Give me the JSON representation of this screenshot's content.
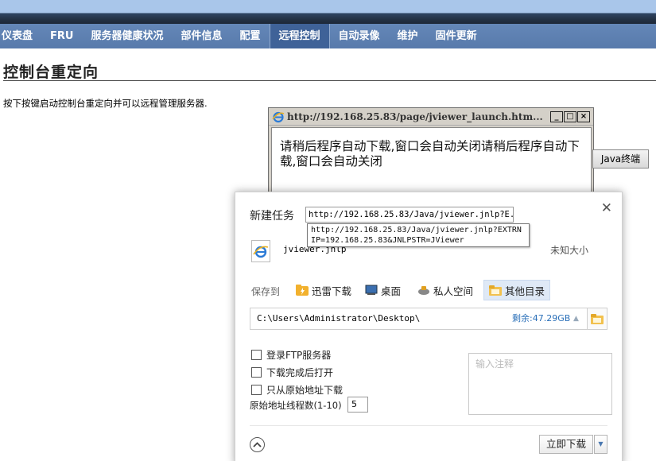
{
  "nav": {
    "items": [
      {
        "label": "仪表盘"
      },
      {
        "label": "FRU"
      },
      {
        "label": "服务器健康状况"
      },
      {
        "label": "部件信息"
      },
      {
        "label": "配置"
      },
      {
        "label": "远程控制",
        "active": true
      },
      {
        "label": "自动录像"
      },
      {
        "label": "维护"
      },
      {
        "label": "固件更新"
      }
    ]
  },
  "page": {
    "title": "控制台重定向",
    "description": "按下按键启动控制台重定向并可以远程管理服务器."
  },
  "popup": {
    "title": "http://192.168.25.83/page/jviewer_launch.htm...",
    "message": "请稍后程序自动下载,窗口会自动关闭请稍后程序自动下载,窗口会自动关闭",
    "buttons": {
      "minimize": "_",
      "maximize": "□",
      "close": "×"
    }
  },
  "java_button": "Java终端",
  "download_dialog": {
    "label": "新建任务",
    "url": "http://192.168.25.83/Java/jviewer.jnlp?E...",
    "url_tooltip": "http://192.168.25.83/Java/jviewer.jnlp?EXTRNIP=192.168.25.83&JNLPSTR=JViewer",
    "file_name": "jviewer.jnlp",
    "file_size": "未知大小",
    "save_to_label": "保存到",
    "destinations": [
      {
        "label": "迅雷下载",
        "icon": "thunder-folder-icon"
      },
      {
        "label": "桌面",
        "icon": "desktop-icon"
      },
      {
        "label": "私人空间",
        "icon": "private-space-icon"
      },
      {
        "label": "其他目录",
        "icon": "folder-icon",
        "selected": true
      }
    ],
    "path": "C:\\Users\\Administrator\\Desktop\\",
    "free_space": "剩余:47.29GB",
    "options": [
      {
        "label": "登录FTP服务器",
        "checked": false
      },
      {
        "label": "下载完成后打开",
        "checked": false
      },
      {
        "label": "只从原始地址下载",
        "checked": false
      }
    ],
    "threads_label": "原始地址线程数(1-10)",
    "threads_value": "5",
    "note_placeholder": "输入注释",
    "download_button": "立即下载",
    "colors": {
      "accent": "#2a6fb8",
      "nav_bg": "#5f83b4",
      "selected_dest": "#dfe9f6"
    }
  }
}
